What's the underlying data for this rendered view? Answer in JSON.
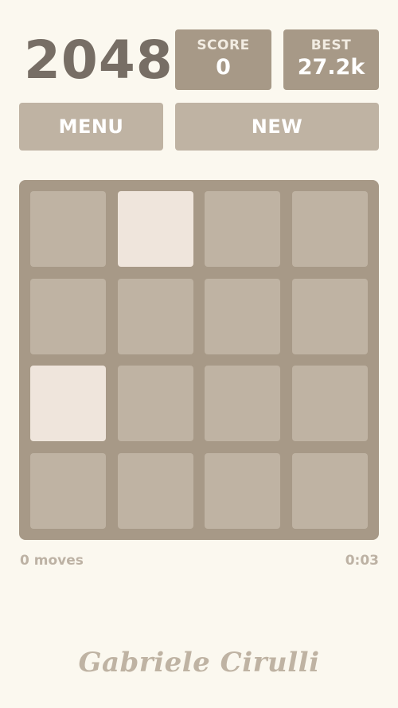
{
  "game": {
    "title": "2048",
    "score_label": "SCORE",
    "score_value": "0",
    "best_label": "BEST",
    "best_value": "27.2k"
  },
  "buttons": {
    "menu_label": "MENU",
    "new_label": "NEW"
  },
  "board": {
    "rows": 4,
    "cols": 4,
    "tiles": [
      [
        "",
        "",
        "",
        ""
      ],
      [
        "",
        "",
        "",
        ""
      ],
      [
        "",
        "",
        "",
        ""
      ],
      [
        "",
        "",
        "",
        ""
      ]
    ],
    "highlighted": [
      [
        0,
        1
      ],
      [
        2,
        0
      ]
    ]
  },
  "status": {
    "moves": "0 moves",
    "timer": "0:03"
  },
  "footer": {
    "signature": "Gabriele Cirulli"
  },
  "colors": {
    "background": "#fbf8ef",
    "board": "#a79987",
    "empty_cell": "#bfb3a3",
    "tile_2": "#efe5dc",
    "title_text": "#776e65"
  }
}
